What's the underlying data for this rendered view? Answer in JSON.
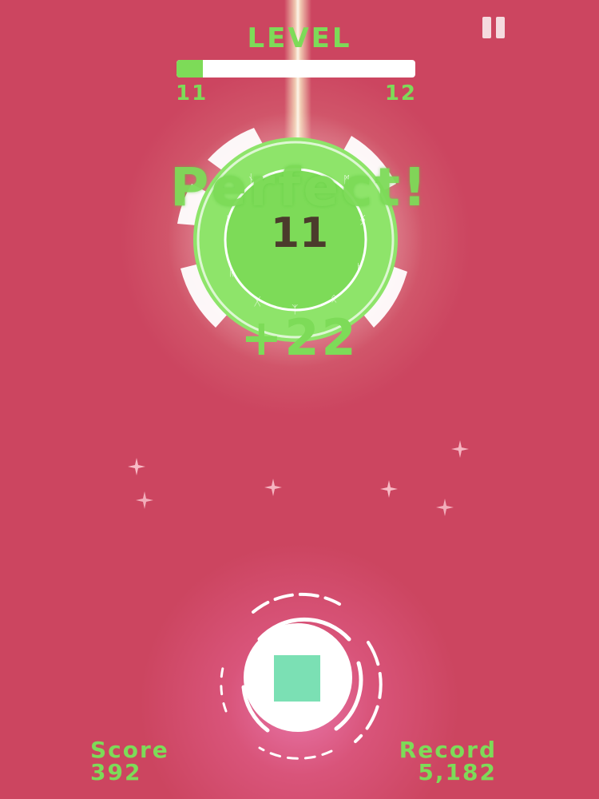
{
  "hud": {
    "level_title": "LEVEL",
    "level_current": "11",
    "level_next": "12",
    "level_progress": 0.11
  },
  "target": {
    "number": "11",
    "color": "#7ddb58"
  },
  "feedback": {
    "text": "Perfect!",
    "points_gain": "+22"
  },
  "score": {
    "label": "Score",
    "value": "392"
  },
  "record": {
    "label": "Record",
    "value": "5,182"
  },
  "controls": {
    "pause_icon": "pause-icon"
  },
  "colors": {
    "background": "#cc4560",
    "accent": "#7ddb58",
    "player_square": "#7be0b4"
  }
}
